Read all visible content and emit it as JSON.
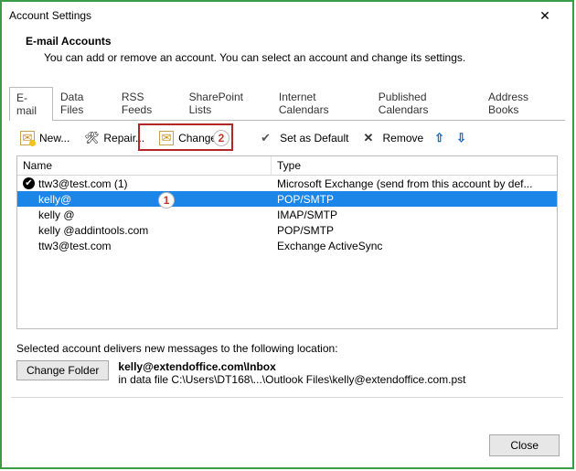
{
  "window": {
    "title": "Account Settings"
  },
  "section": {
    "heading": "E-mail Accounts",
    "description": "You can add or remove an account. You can select an account and change its settings."
  },
  "tabs": [
    {
      "key": "email",
      "label": "E-mail",
      "active": true
    },
    {
      "key": "data",
      "label": "Data Files",
      "active": false
    },
    {
      "key": "rss",
      "label": "RSS Feeds",
      "active": false
    },
    {
      "key": "sp",
      "label": "SharePoint Lists",
      "active": false
    },
    {
      "key": "ical",
      "label": "Internet Calendars",
      "active": false
    },
    {
      "key": "pub",
      "label": "Published Calendars",
      "active": false
    },
    {
      "key": "ab",
      "label": "Address Books",
      "active": false
    }
  ],
  "toolbar": {
    "new": "New...",
    "repair": "Repair...",
    "change": "Change...",
    "setdefault": "Set as Default",
    "remove": "Remove"
  },
  "annotations": {
    "badge1": "1",
    "badge2": "2"
  },
  "columns": {
    "name": "Name",
    "type": "Type"
  },
  "accounts": [
    {
      "name": "ttw3@test.com (1)",
      "type": "Microsoft Exchange (send from this account by def...",
      "default": true,
      "selected": false
    },
    {
      "name": "kelly@",
      "type": "POP/SMTP",
      "default": false,
      "selected": true
    },
    {
      "name": "kelly         @",
      "type": "IMAP/SMTP",
      "default": false,
      "selected": false
    },
    {
      "name": "kelly       @addintools.com",
      "type": "POP/SMTP",
      "default": false,
      "selected": false
    },
    {
      "name": "ttw3@test.com",
      "type": "Exchange ActiveSync",
      "default": false,
      "selected": false
    }
  ],
  "footer": {
    "caption": "Selected account delivers new messages to the following location:",
    "change_folder": "Change Folder",
    "location_bold": "kelly@extendoffice.com\\Inbox",
    "location_detail": "in data file C:\\Users\\DT168\\...\\Outlook Files\\kelly@extendoffice.com.pst"
  },
  "close_label": "Close"
}
